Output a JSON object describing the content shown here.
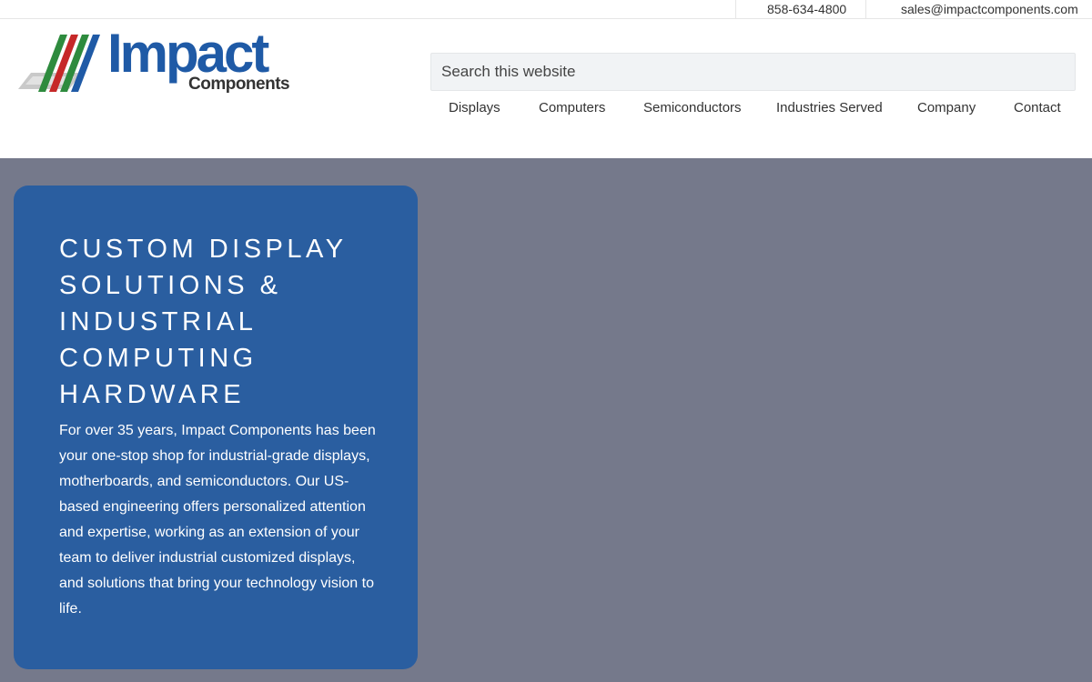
{
  "topbar": {
    "phone": "858-634-4800",
    "email": "sales@impactcomponents.com"
  },
  "logo": {
    "name": "Impact",
    "sub": "Components",
    "colors": [
      "#2e8b3e",
      "#c62828",
      "#2e8b3e",
      "#1f5aa6"
    ]
  },
  "search": {
    "placeholder": "Search this website"
  },
  "nav": {
    "items": [
      {
        "label": "Displays"
      },
      {
        "label": "Computers"
      },
      {
        "label": "Semiconductors"
      },
      {
        "label": "Industries Served"
      },
      {
        "label": "Company"
      },
      {
        "label": "Contact"
      }
    ]
  },
  "hero": {
    "title": "Custom Display Solutions & Industrial Computing Hardware",
    "text": "For over 35 years, Impact Components has been your one-stop shop for industrial-grade displays, motherboards, and semiconductors. Our US-based engineering offers personalized attention and expertise, working as an extension of your team to deliver industrial customized displays, and solutions that bring your technology vision to life.",
    "card_color": "#2a5ea0",
    "background_color": "#75798b"
  }
}
